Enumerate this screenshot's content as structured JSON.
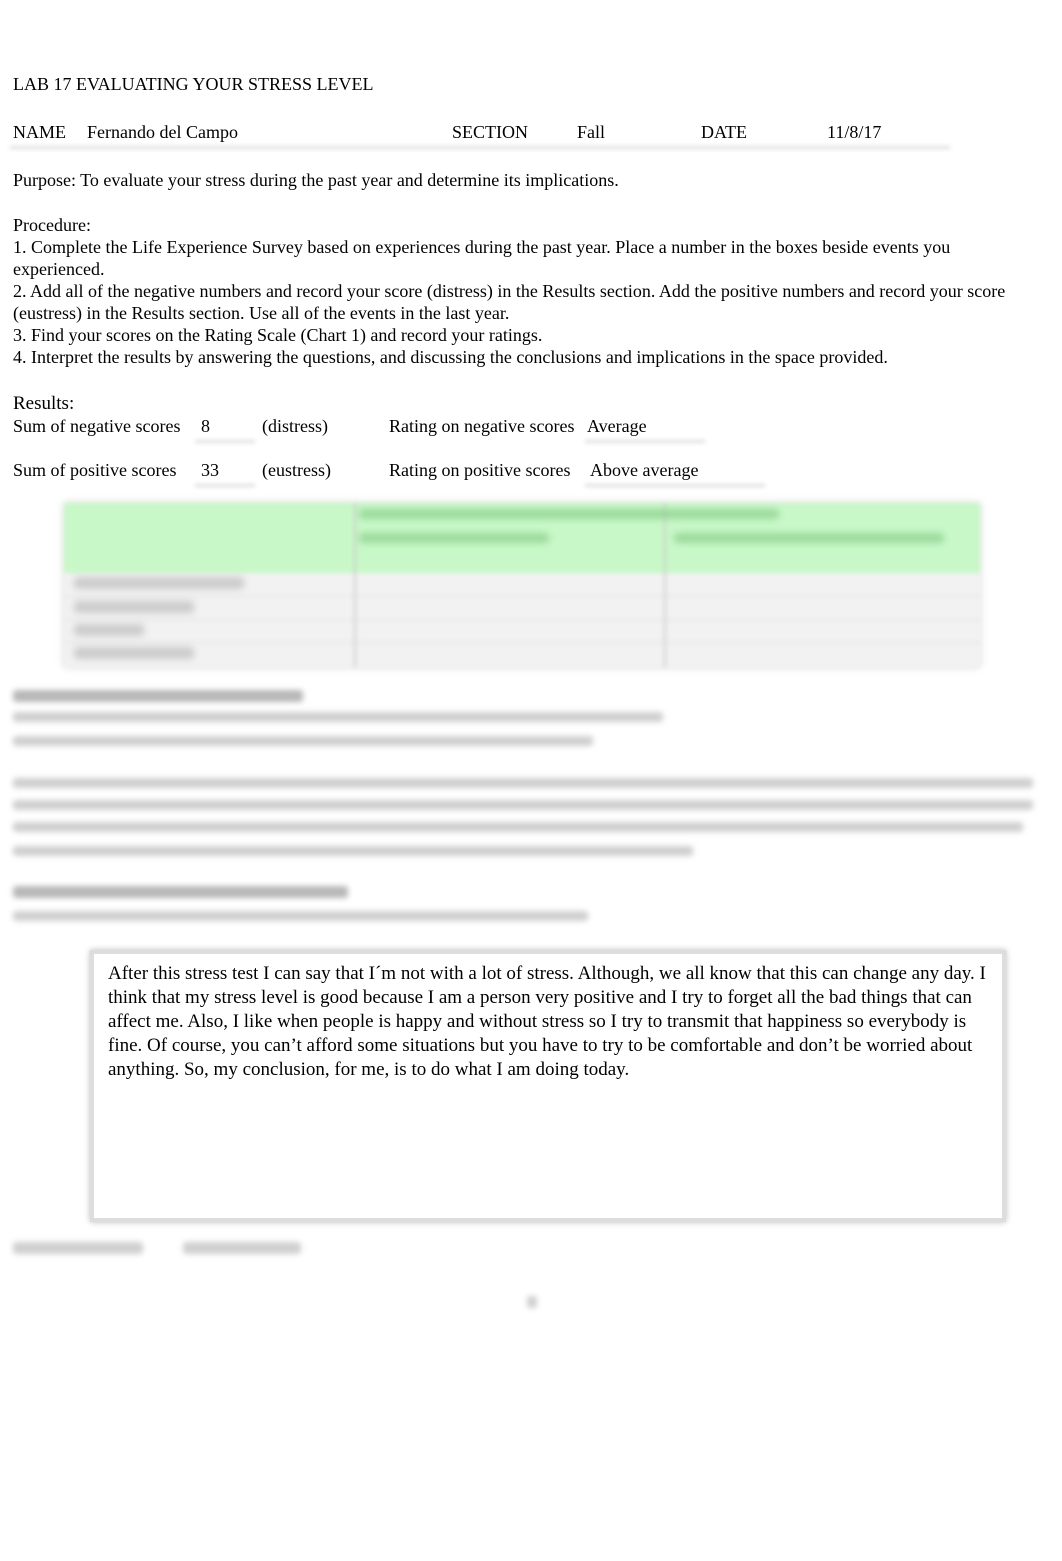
{
  "header": {
    "title": "LAB 17 EVALUATING YOUR STRESS LEVEL",
    "name_label": "NAME",
    "name_value": "Fernando del Campo",
    "section_label": "SECTION",
    "section_value": "Fall",
    "date_label": "DATE",
    "date_value": "11/8/17"
  },
  "purpose": "Purpose: To evaluate your stress during the past year and determine its implications.",
  "procedure": {
    "title": "Procedure:",
    "steps": [
      "1. Complete the Life Experience Survey based on experiences during the past year. Place a number in the boxes beside events you experienced.",
      "2. Add all of the negative numbers and record your score (distress) in the Results section. Add the positive numbers and record your score (eustress) in the Results section. Use all of the events in the last year.",
      "3. Find your scores on the Rating Scale (Chart 1) and record your ratings.",
      "4. Interpret the results by answering the questions, and discussing the conclusions and implications in the space provided."
    ]
  },
  "results": {
    "title": "Results:",
    "negative": {
      "label": "Sum of negative scores",
      "value": "8",
      "type": "(distress)",
      "rating_label": "Rating on negative scores",
      "rating": "Average"
    },
    "positive": {
      "label": "Sum of positive scores",
      "value": "33",
      "type": "(eustress)",
      "rating_label": "Rating on positive scores",
      "rating": "Above average"
    }
  },
  "conclusion": "After this stress test I can say that I´m not with a lot of stress. Although, we all know that this can change any day. I think that my stress level is good because I am a person very positive and I try to forget all the bad things that can affect me. Also, I like when people is happy and without stress so I try to transmit that happiness so everybody is fine. Of course, you can’t afford some situations but you have to try to be comfortable and don’t be worried about anything. So, my conclusion, for me, is to do what I am doing today.",
  "colors": {
    "table_header": "#c8f8c8",
    "table_body": "#f2f2f2"
  }
}
